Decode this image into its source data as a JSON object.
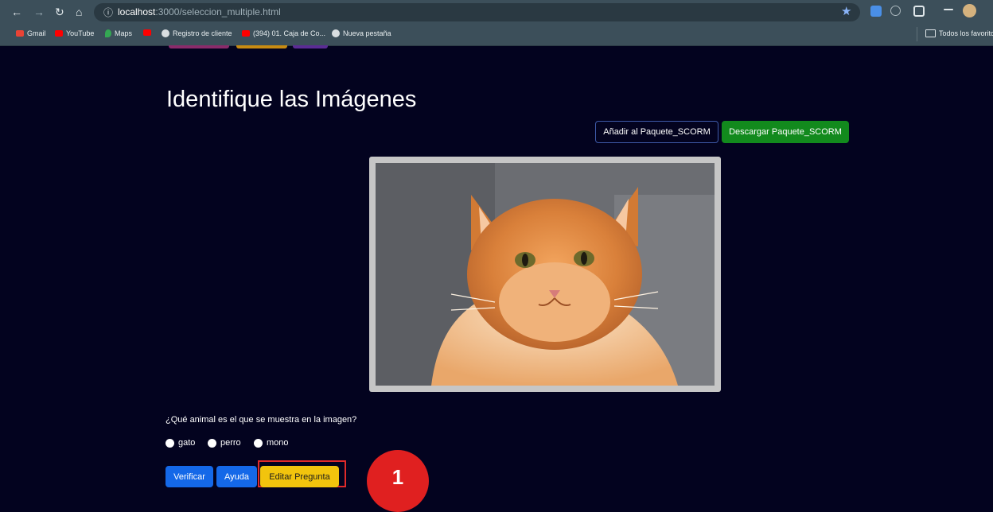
{
  "browser": {
    "url_host": "localhost",
    "url_path": ":3000/seleccion_multiple.html",
    "icons": [
      "back-icon",
      "forward-icon",
      "reload-icon",
      "home-icon",
      "info-icon",
      "star-icon"
    ],
    "bookmarks": [
      {
        "label": "Gmail",
        "icon": "gmail-icon"
      },
      {
        "label": "YouTube",
        "icon": "youtube-icon"
      },
      {
        "label": "Maps",
        "icon": "maps-icon"
      },
      {
        "label": "",
        "icon": "youtube-icon"
      },
      {
        "label": "Registro de cliente",
        "icon": "globe-icon"
      },
      {
        "label": "(394) 01. Caja de Co...",
        "icon": "youtube-icon"
      },
      {
        "label": "Nueva pestaña",
        "icon": "globe-icon"
      }
    ],
    "bookmarks_folder": "Todos los favorito"
  },
  "page": {
    "title": "Identifique las Imágenes",
    "buttons": {
      "add_scorm": "Añadir al Paquete_SCORM",
      "download_scorm": "Descargar Paquete_SCORM"
    },
    "image": {
      "subject": "cat-photo"
    },
    "question": "¿Qué animal es el que se muestra en la imagen?",
    "options": [
      "gato",
      "perro",
      "mono"
    ],
    "actions": {
      "verify": "Verificar",
      "help": "Ayuda",
      "edit": "Editar Pregunta"
    }
  },
  "annotation": {
    "step": "1"
  },
  "colors": {
    "page_bg": "#03031f",
    "chrome_bg": "#3c4f5a",
    "primary": "#1468e8",
    "success": "#128a1d",
    "warning": "#f2c40d",
    "highlight": "#e02a2a"
  }
}
